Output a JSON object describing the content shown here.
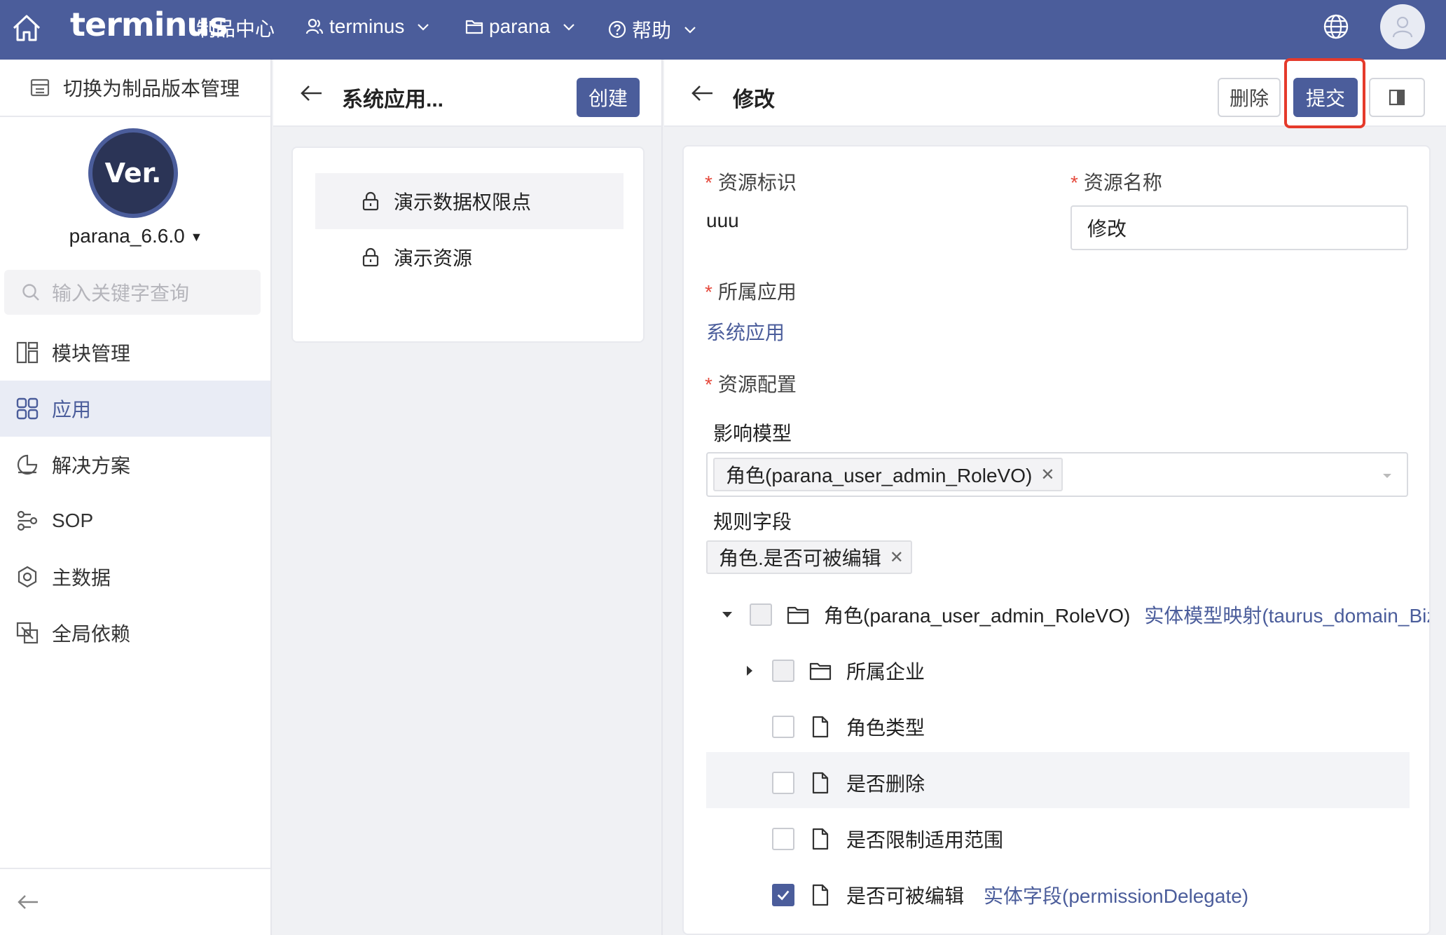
{
  "topbar": {
    "brand": "terminus",
    "brand_sub": "制品中心",
    "user": "terminus",
    "project": "parana",
    "help": "帮助"
  },
  "sidebar": {
    "switch_label": "切换为制品版本管理",
    "logo_text": "Ver.",
    "version": "parana_6.6.0",
    "search_placeholder": "输入关键字查询",
    "items": [
      {
        "label": "模块管理",
        "icon": "module-icon"
      },
      {
        "label": "应用",
        "icon": "app-grid-icon",
        "active": true
      },
      {
        "label": "解决方案",
        "icon": "solution-icon"
      },
      {
        "label": "SOP",
        "icon": "sop-icon"
      },
      {
        "label": "主数据",
        "icon": "master-data-icon"
      },
      {
        "label": "全局依赖",
        "icon": "dependency-icon"
      }
    ]
  },
  "middle": {
    "title": "系统应用...",
    "create_label": "创建",
    "resources": [
      {
        "label": "演示数据权限点",
        "selected": true
      },
      {
        "label": "演示资源"
      }
    ]
  },
  "right": {
    "title": "修改",
    "delete_label": "删除",
    "submit_label": "提交",
    "form": {
      "resource_id_label": "资源标识",
      "resource_id_value": "uuu",
      "resource_name_label": "资源名称",
      "resource_name_value": "修改",
      "app_label": "所属应用",
      "app_value": "系统应用",
      "config_label": "资源配置",
      "model_label": "影响模型",
      "model_tag": "角色(parana_user_admin_RoleVO)",
      "rule_label": "规则字段",
      "rule_tag": "角色.是否可被编辑"
    },
    "tree": {
      "root": {
        "label": "角色(parana_user_admin_RoleVO)",
        "link": "实体模型映射(taurus_domain_BizOb"
      },
      "children": [
        {
          "label": "所属企业",
          "type": "folder"
        },
        {
          "label": "角色类型",
          "type": "file"
        },
        {
          "label": "是否删除",
          "type": "file"
        },
        {
          "label": "是否限制适用范围",
          "type": "file"
        },
        {
          "label": "是否可被编辑",
          "type": "file",
          "checked": true,
          "link": "实体字段(permissionDelegate)"
        }
      ]
    }
  },
  "colors": {
    "primary": "#4b5d9b",
    "highlight": "#e53a2b",
    "required": "#e5493c"
  }
}
